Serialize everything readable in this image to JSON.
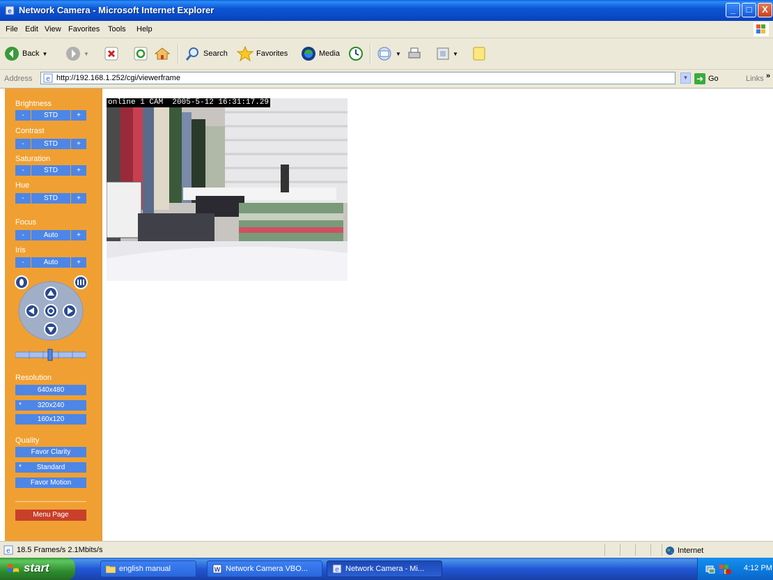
{
  "window": {
    "title": "Network Camera - Microsoft Internet Explorer",
    "minimize": "_",
    "maximize": "□",
    "close": "X"
  },
  "menubar": {
    "items": [
      "File",
      "Edit",
      "View",
      "Favorites",
      "Tools",
      "Help"
    ]
  },
  "toolbar": {
    "back": "Back",
    "search": "Search",
    "favorites": "Favorites",
    "media": "Media"
  },
  "address": {
    "label": "Address",
    "url": "http://192.168.1.252/cgi/viewerframe",
    "go": "Go",
    "links": "Links",
    "chevron": "»"
  },
  "sidebar": {
    "minus": "-",
    "plus": "+",
    "controls": [
      {
        "label": "Brightness",
        "value": "STD"
      },
      {
        "label": "Contrast",
        "value": "STD"
      },
      {
        "label": "Saturation",
        "value": "STD"
      },
      {
        "label": "Hue",
        "value": "STD"
      },
      {
        "label": "Focus",
        "value": "Auto"
      },
      {
        "label": "Iris",
        "value": "Auto"
      }
    ],
    "resolution": {
      "label": "Resolution",
      "options": [
        "640x480",
        "320x240",
        "160x120"
      ],
      "selected_marker": "*",
      "selected_index": 1
    },
    "quality": {
      "label": "Quality",
      "options": [
        "Favor Clarity",
        "Standard",
        "Favor Motion"
      ],
      "selected_marker": "*",
      "selected_index": 1
    },
    "menu_page": "Menu Page"
  },
  "camera": {
    "osd": "online 1 CAM  2005-5-12 16:31:17.29"
  },
  "statusbar": {
    "text": "18.5 Frames/s 2.1Mbits/s",
    "zone": "Internet"
  },
  "taskbar": {
    "start": "start",
    "tasks": [
      "english manual",
      "Network Camera VBO...",
      "Network Camera - Mi..."
    ],
    "active_index": 2,
    "clock": "4:12 PM"
  },
  "colors": {
    "sidebar_bg": "#f0a032",
    "button_blue": "#4e86e6",
    "menu_page_red": "#c8402a",
    "titlebar_blue": "#0846c2"
  }
}
